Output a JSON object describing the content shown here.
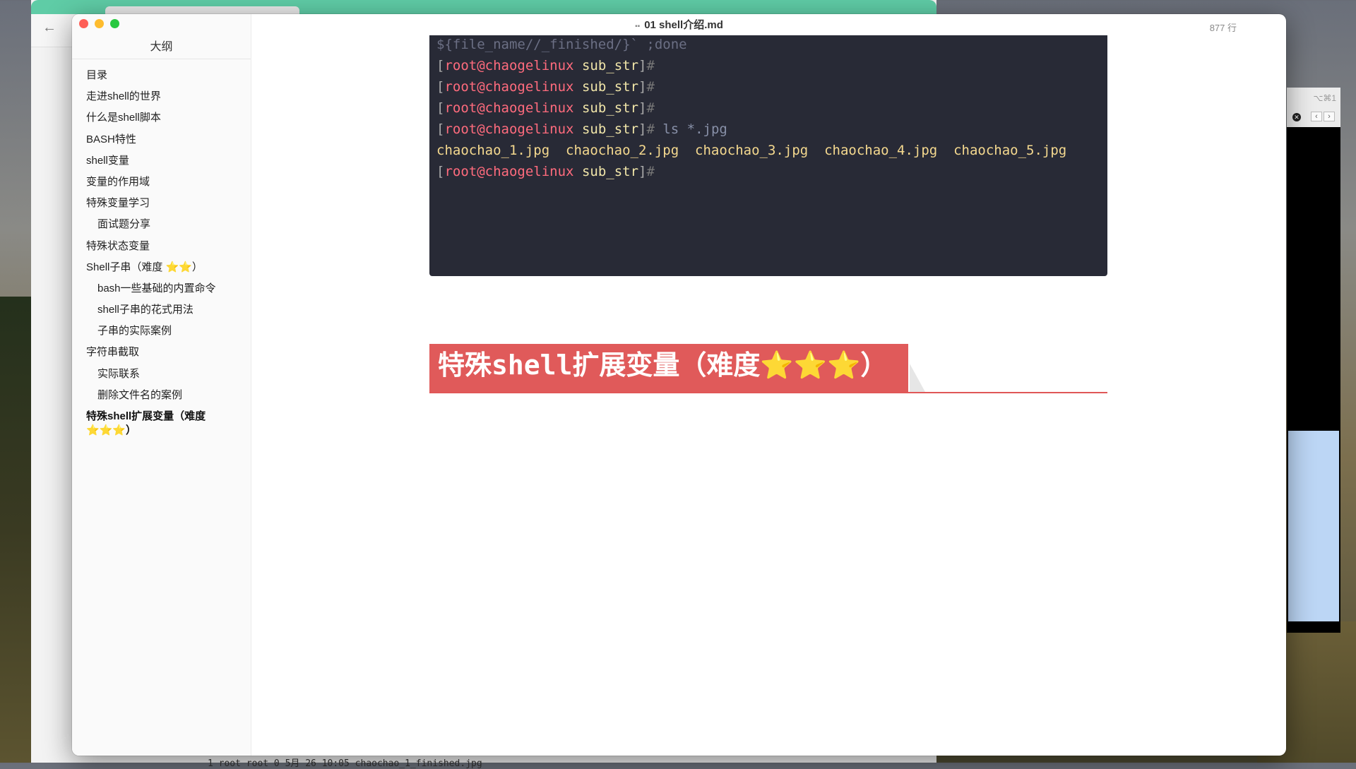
{
  "window": {
    "title": "01 shell介绍.md",
    "line_count": "877 行"
  },
  "sidebar": {
    "heading": "大纲",
    "items": [
      {
        "label": "目录",
        "sub": false
      },
      {
        "label": "走进shell的世界",
        "sub": false
      },
      {
        "label": "什么是shell脚本",
        "sub": false
      },
      {
        "label": "BASH特性",
        "sub": false
      },
      {
        "label": "shell变量",
        "sub": false
      },
      {
        "label": "变量的作用域",
        "sub": false
      },
      {
        "label": "特殊变量学习",
        "sub": false
      },
      {
        "label": "面试题分享",
        "sub": true
      },
      {
        "label": "特殊状态变量",
        "sub": false
      },
      {
        "label": "Shell子串（难度 ⭐⭐）",
        "sub": false
      },
      {
        "label": "bash一些基础的内置命令",
        "sub": true
      },
      {
        "label": "shell子串的花式用法",
        "sub": true
      },
      {
        "label": "子串的实际案例",
        "sub": true
      },
      {
        "label": "字符串截取",
        "sub": false
      },
      {
        "label": "实际联系",
        "sub": true
      },
      {
        "label": "删除文件名的案例",
        "sub": true
      },
      {
        "label": "特殊shell扩展变量（难度⭐⭐⭐）",
        "sub": false,
        "active": true
      }
    ]
  },
  "code": {
    "first_line": "${file_name//_finished/}` ;done",
    "prompt_user": "root@chaogelinux",
    "prompt_dir": "sub_str",
    "command": "ls *.jpg",
    "files": "chaochao_1.jpg  chaochao_2.jpg  chaochao_3.jpg  chaochao_4.jpg  chaochao_5.jpg"
  },
  "heading": {
    "text_prefix": "特殊",
    "text_mono": "shell",
    "text_suffix": "扩展变量（难度⭐⭐⭐）"
  },
  "side_window": {
    "shortcut": "⌥⌘1"
  },
  "background_terminal_line": "1 root root 0 5月  26 10:05 chaochao_1_finished.jpg",
  "colors": {
    "heading_bg": "#e05a5a",
    "code_bg": "#282a36",
    "chrome_green": "#5fcca6"
  }
}
